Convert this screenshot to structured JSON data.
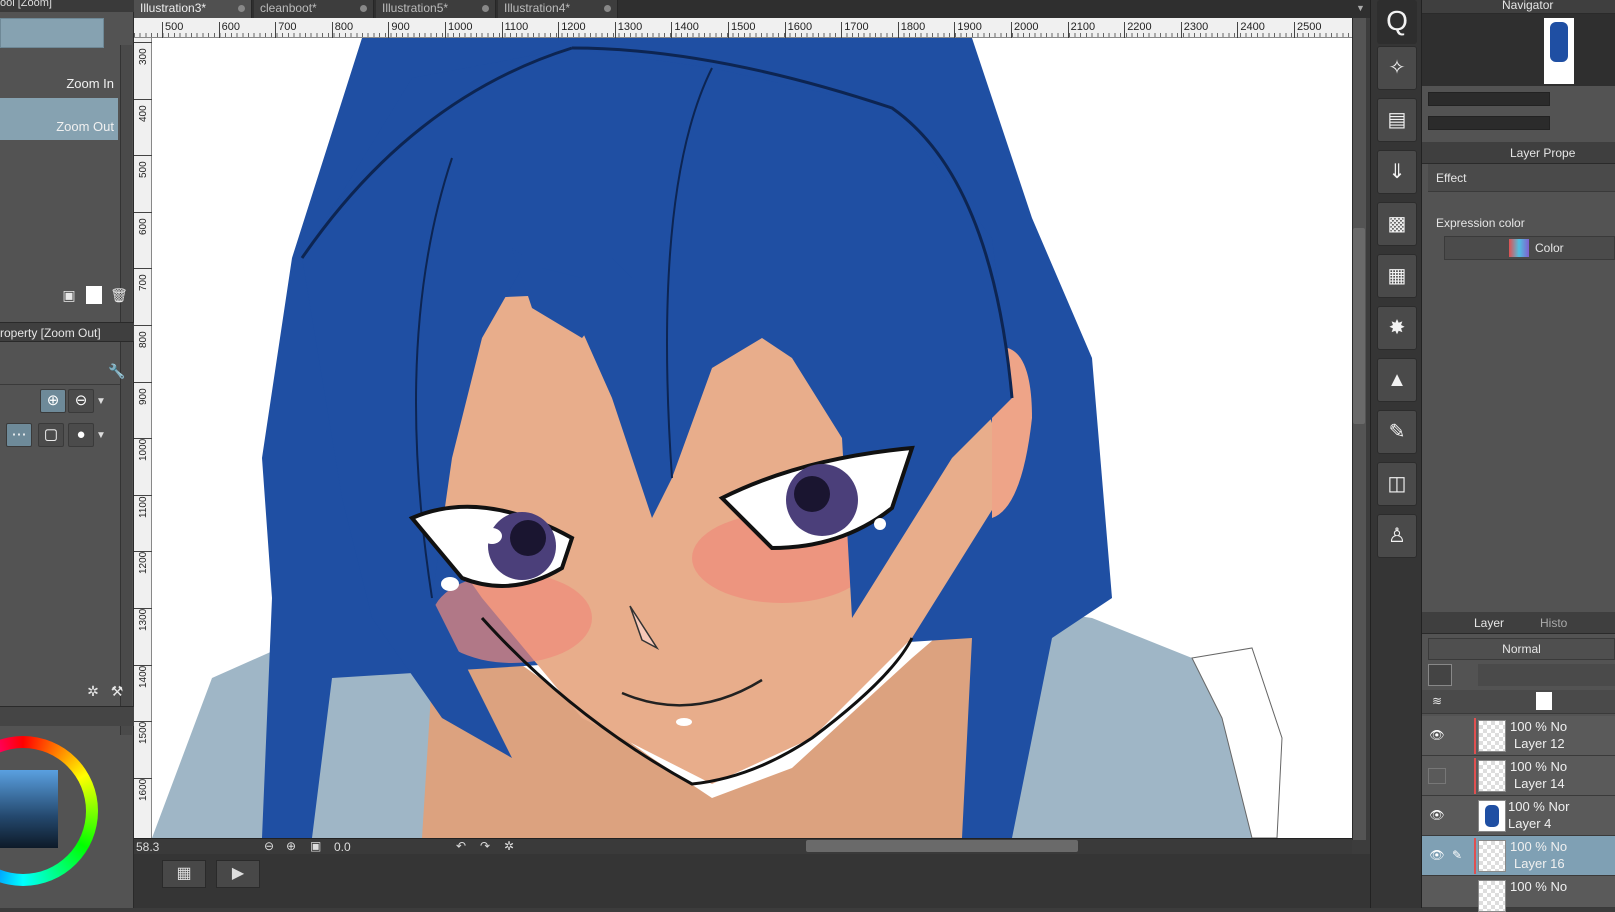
{
  "left_panel": {
    "tool_title": "ool [Zoom]",
    "sub_tools": [
      "Zoom In",
      "Zoom Out"
    ],
    "property_title": "roperty [Zoom Out]",
    "icons": [
      "new-folder-icon",
      "new-layer-icon",
      "trash-icon",
      "wrench-icon",
      "zoom-in-icon",
      "zoom-out-icon",
      "brush-size-icon",
      "circle-brush-icon"
    ]
  },
  "tabs": [
    {
      "label": "Illustration3*",
      "active": true
    },
    {
      "label": "cleanboot*",
      "active": false
    },
    {
      "label": "Illustration5*",
      "active": false
    },
    {
      "label": "Illustration4*",
      "active": false
    }
  ],
  "ruler": {
    "top": [
      "500",
      "600",
      "700",
      "800",
      "900",
      "1000",
      "1100",
      "1200",
      "1300",
      "1400",
      "1500",
      "1600",
      "1700",
      "1800",
      "1900",
      "2000",
      "2100",
      "2200",
      "2300",
      "2400",
      "2500"
    ],
    "left": [
      "300",
      "400",
      "500",
      "600",
      "700",
      "800",
      "900",
      "1000",
      "1100",
      "1200",
      "1300",
      "1400",
      "1500",
      "1600"
    ]
  },
  "status": {
    "zoom": "58.3",
    "rotation": "0.0"
  },
  "navigator": {
    "title": "Navigator"
  },
  "layer_property": {
    "title": "Layer Prope",
    "effect_label": "Effect",
    "expression_color_label": "Expression color",
    "color_value": "Color"
  },
  "layer_panel": {
    "tab_layer": "Layer",
    "tab_history": "Histo",
    "blend_mode": "Normal",
    "layers": [
      {
        "opacity": "100 % No",
        "name": "Layer 12",
        "visible": true,
        "selected": false
      },
      {
        "opacity": "100 % No",
        "name": "Layer 14",
        "visible": false,
        "selected": false
      },
      {
        "opacity": "100 % Nor",
        "name": "Layer 4",
        "visible": true,
        "selected": false
      },
      {
        "opacity": "100 % No",
        "name": "Layer 16",
        "visible": true,
        "selected": true
      },
      {
        "opacity": "100 % No",
        "name": "",
        "visible": true,
        "selected": false
      }
    ]
  },
  "colors": {
    "accent": "#86a2b1",
    "hair": "#1f4fa3",
    "skin": "#e8ad8b",
    "shirt": "#9fb6c6"
  }
}
